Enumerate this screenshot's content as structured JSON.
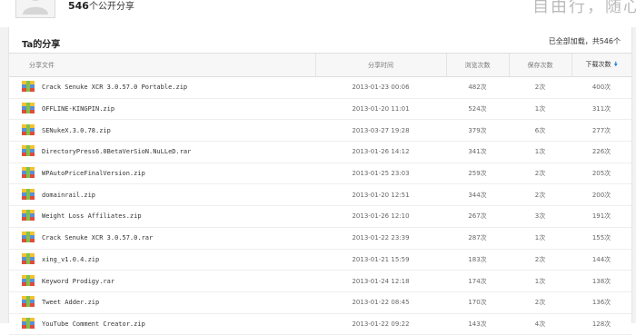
{
  "profile": {
    "share_count": "546",
    "share_count_suffix": "个公开分享",
    "slogan": "自由行，随心"
  },
  "panel": {
    "title": "Ta的分享",
    "status": "已全部加载，共546个"
  },
  "table": {
    "headers": {
      "file": "分享文件",
      "time": "分享时间",
      "views": "浏览次数",
      "saves": "保存次数",
      "downloads": "下载次数"
    },
    "rows": [
      {
        "name": "Crack Senuke XCR 3.0.57.0 Portable.zip",
        "time": "2013-01-23 00:06",
        "views": "482次",
        "saves": "2次",
        "downloads": "400次"
      },
      {
        "name": "OFFLINE-KINGPIN.zip",
        "time": "2013-01-20 11:01",
        "views": "524次",
        "saves": "1次",
        "downloads": "311次"
      },
      {
        "name": "SENukeX.3.0.78.zip",
        "time": "2013-03-27 19:28",
        "views": "379次",
        "saves": "6次",
        "downloads": "277次"
      },
      {
        "name": "DirectoryPress6.0BetaVerSioN.NuLLeD.rar",
        "time": "2013-01-26 14:12",
        "views": "341次",
        "saves": "1次",
        "downloads": "226次"
      },
      {
        "name": "WPAutoPriceFinalVersion.zip",
        "time": "2013-01-25 23:03",
        "views": "259次",
        "saves": "2次",
        "downloads": "205次"
      },
      {
        "name": "domainrail.zip",
        "time": "2013-01-20 12:51",
        "views": "344次",
        "saves": "2次",
        "downloads": "200次"
      },
      {
        "name": "Weight Loss Affiliates.zip",
        "time": "2013-01-26 12:10",
        "views": "267次",
        "saves": "3次",
        "downloads": "191次"
      },
      {
        "name": "Crack Senuke XCR 3.0.57.0.rar",
        "time": "2013-01-22 23:39",
        "views": "287次",
        "saves": "1次",
        "downloads": "155次"
      },
      {
        "name": "xing_v1.0.4.zip",
        "time": "2013-01-21 15:59",
        "views": "183次",
        "saves": "2次",
        "downloads": "144次"
      },
      {
        "name": "Keyword Prodigy.rar",
        "time": "2013-01-24 12:18",
        "views": "174次",
        "saves": "1次",
        "downloads": "138次"
      },
      {
        "name": "Tweet Adder.zip",
        "time": "2013-01-22 08:45",
        "views": "170次",
        "saves": "2次",
        "downloads": "136次"
      },
      {
        "name": "YouTube Comment Creator.zip",
        "time": "2013-01-22 09:22",
        "views": "143次",
        "saves": "4次",
        "downloads": "128次"
      }
    ]
  },
  "colors": {
    "accent": "#1e88e5",
    "header_bg": "#f7f7f7",
    "page_bg": "#f2f2f2"
  },
  "icons": {
    "file": "archive-file-icon",
    "sort": "sort-desc-icon",
    "avatar": "default-avatar-icon"
  }
}
